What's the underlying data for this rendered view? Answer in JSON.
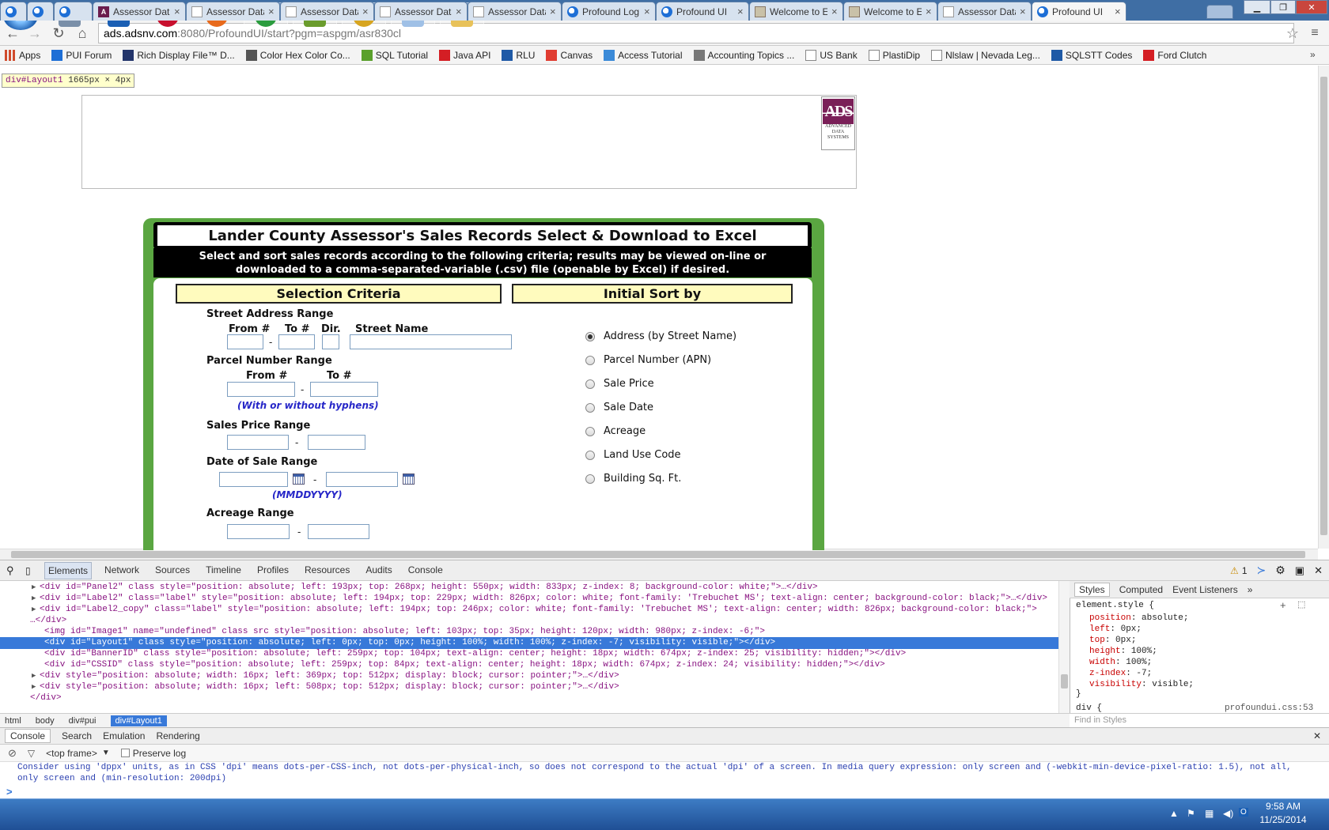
{
  "browser": {
    "tabs": [
      {
        "title": "",
        "icon": "firefox-icon",
        "active": false
      },
      {
        "title": "",
        "icon": "firefox-icon",
        "active": false
      },
      {
        "title": "",
        "icon": "firefox-icon",
        "active": false
      },
      {
        "title": "Assessor Data",
        "icon": "ads-icon",
        "active": false
      },
      {
        "title": "Assessor Data",
        "icon": "document-icon",
        "active": false
      },
      {
        "title": "Assessor Data",
        "icon": "document-icon",
        "active": false
      },
      {
        "title": "Assessor Data",
        "icon": "document-icon",
        "active": false
      },
      {
        "title": "Assessor Data",
        "icon": "document-icon",
        "active": false
      },
      {
        "title": "Profound Log",
        "icon": "firefox-icon",
        "active": false
      },
      {
        "title": "Profound UI",
        "icon": "firefox-icon",
        "active": false
      },
      {
        "title": "Welcome to E",
        "icon": "window-icon",
        "active": false
      },
      {
        "title": "Welcome to E",
        "icon": "window-icon",
        "active": false
      },
      {
        "title": "Assessor Data",
        "icon": "document-icon",
        "active": false
      },
      {
        "title": "Profound UI",
        "icon": "firefox-icon",
        "active": true
      }
    ],
    "url_host": "ads.adsnv.com",
    "url_path": ":8080/ProfoundUI/start?pgm=aspgm/asr830cl",
    "bookmarks": [
      {
        "label": "Apps",
        "icon": "apps-grid-icon",
        "color": "#d04a2c"
      },
      {
        "label": "PUI Forum",
        "icon": "firefox-icon",
        "color": "#1e6fd6"
      },
      {
        "label": "Rich Display File™ D...",
        "icon": "x-logo-icon",
        "color": "#23356b"
      },
      {
        "label": "Color Hex Color Co...",
        "icon": "pin-icon",
        "color": "#555555"
      },
      {
        "label": "SQL Tutorial",
        "icon": "w3-icon",
        "color": "#5aa02c"
      },
      {
        "label": "Java API",
        "icon": "oracle-icon",
        "color": "#d41e24"
      },
      {
        "label": "RLU",
        "icon": "ibm-icon",
        "color": "#1f5aa6"
      },
      {
        "label": "Canvas",
        "icon": "canvas-icon",
        "color": "#e03c31"
      },
      {
        "label": "Access Tutorial",
        "icon": "globe-icon",
        "color": "#3b8ad8"
      },
      {
        "label": "Accounting Topics ...",
        "icon": "ac-icon",
        "color": "#777777"
      },
      {
        "label": "US Bank",
        "icon": "document-icon",
        "color": "#888888"
      },
      {
        "label": "PlastiDip",
        "icon": "document-icon",
        "color": "#888888"
      },
      {
        "label": "Nlslaw | Nevada Leg...",
        "icon": "document-icon",
        "color": "#888888"
      },
      {
        "label": "SQLSTT Codes",
        "icon": "ibm-icon",
        "color": "#1f5aa6"
      },
      {
        "label": "Ford Clutch",
        "icon": "az-icon",
        "color": "#d41e24"
      }
    ]
  },
  "inspect_tooltip": {
    "element": "div#Layout1",
    "size": "1665px × 4px"
  },
  "logo": {
    "mark": "ADS",
    "lines": [
      "ADVANCED",
      "DATA",
      "SYSTEMS"
    ],
    "color": "#7a2058"
  },
  "app": {
    "title": "Lander County Assessor's Sales Records Select & Download to Excel",
    "subtitle_line1": "Select and sort sales records according to the following criteria; results may be viewed on-line or",
    "subtitle_line2": "downloaded to a comma-separated-variable (.csv) file (openable by Excel) if desired.",
    "selection_header": "Selection Criteria",
    "sort_header": "Initial Sort by",
    "street": {
      "label": "Street Address Range",
      "from": "From #",
      "to": "To #",
      "dir": "Dir.",
      "name": "Street Name",
      "from_value": "",
      "to_value": "",
      "dir_value": "",
      "name_value": ""
    },
    "parcel": {
      "label": "Parcel Number Range",
      "from": "From #",
      "to": "To #",
      "hint": "(With or without hyphens)",
      "from_value": "",
      "to_value": ""
    },
    "price": {
      "label": "Sales Price Range",
      "from_value": "",
      "to_value": ""
    },
    "date": {
      "label": "Date of Sale Range",
      "hint": "(MMDDYYYY)",
      "from_value": "",
      "to_value": ""
    },
    "acreage": {
      "label": "Acreage Range",
      "from_value": "",
      "to_value": ""
    },
    "dash": "-",
    "sort_options": [
      {
        "label": "Address (by Street Name)",
        "selected": true
      },
      {
        "label": "Parcel Number (APN)",
        "selected": false
      },
      {
        "label": "Sale Price",
        "selected": false
      },
      {
        "label": "Sale Date",
        "selected": false
      },
      {
        "label": "Acreage",
        "selected": false
      },
      {
        "label": "Land Use Code",
        "selected": false
      },
      {
        "label": "Building Sq. Ft.",
        "selected": false
      }
    ],
    "colors": {
      "panel_green": "#5aa641",
      "header_yellow": "#fffbbe",
      "hint_blue": "#2727c8"
    }
  },
  "devtools": {
    "tabs": [
      "Elements",
      "Network",
      "Sources",
      "Timeline",
      "Profiles",
      "Resources",
      "Audits",
      "Console"
    ],
    "active_tab": "Elements",
    "warning_count": "1",
    "dom_lines": [
      {
        "text": "<div id=\"Panel2\" class style=\"position: absolute; left: 193px; top: 268px; height: 550px; width: 833px; z-index: 8; background-color: white;\">…</div>",
        "arrow": true,
        "selected": false
      },
      {
        "text": "<div id=\"Label2\" class=\"label\" style=\"position: absolute; left: 194px; top: 229px; width: 826px; color: white; font-family: 'Trebuchet MS'; text-align: center; background-color: black;\">…</div>",
        "arrow": true,
        "selected": false
      },
      {
        "text": "<div id=\"Label2_copy\" class=\"label\" style=\"position: absolute; left: 194px; top: 246px; color: white; font-family: 'Trebuchet MS'; text-align: center; width: 826px; background-color: black;\">",
        "arrow": true,
        "selected": false
      },
      {
        "text": "…</div>",
        "arrow": false,
        "selected": false
      },
      {
        "text": "<img id=\"Image1\" name=\"undefined\" class src style=\"position: absolute; left: 103px; top: 35px; height: 120px; width: 980px; z-index: -6;\">",
        "arrow": false,
        "selected": false
      },
      {
        "text": "<div id=\"Layout1\" class style=\"position: absolute; left: 0px; top: 0px; height: 100%; width: 100%; z-index: -7; visibility: visible;\"></div>",
        "arrow": false,
        "selected": true
      },
      {
        "text": "<div id=\"BannerID\" class style=\"position: absolute; left: 259px; top: 104px; text-align: center; height: 18px; width: 674px; z-index: 25; visibility: hidden;\"></div>",
        "arrow": false,
        "selected": false
      },
      {
        "text": "<div id=\"CSSID\" class style=\"position: absolute; left: 259px; top: 84px; text-align: center; height: 18px; width: 674px; z-index: 24; visibility: hidden;\"></div>",
        "arrow": false,
        "selected": false
      },
      {
        "text": "<div style=\"position: absolute; width: 16px; left: 369px; top: 512px; display: block; cursor: pointer;\">…</div>",
        "arrow": true,
        "selected": false
      },
      {
        "text": "<div style=\"position: absolute; width: 16px; left: 508px; top: 512px; display: block; cursor: pointer;\">…</div>",
        "arrow": true,
        "selected": false
      },
      {
        "text": "</div>",
        "arrow": false,
        "selected": false
      }
    ],
    "styles_tabs": [
      "Styles",
      "Computed",
      "Event Listeners"
    ],
    "styles_selector": "element.style {",
    "styles_props": [
      {
        "name": "position",
        "value": "absolute;"
      },
      {
        "name": "left",
        "value": "0px;"
      },
      {
        "name": "top",
        "value": "0px;"
      },
      {
        "name": "height",
        "value": "100%;"
      },
      {
        "name": "width",
        "value": "100%;"
      },
      {
        "name": "z-index",
        "value": "-7;"
      },
      {
        "name": "visibility",
        "value": "visible;"
      }
    ],
    "styles_close": "}",
    "styles_next": "div {",
    "styles_source": "profoundui.css:53",
    "find_placeholder": "Find in Styles",
    "breadcrumbs": [
      "html",
      "body",
      "div#pui",
      "div#Layout1"
    ],
    "drawer_tabs": [
      "Console",
      "Search",
      "Emulation",
      "Rendering"
    ],
    "frame": "<top frame>",
    "preserve_log": "Preserve log",
    "console_message": "Consider using 'dppx' units, as in CSS 'dpi' means dots-per-CSS-inch, not dots-per-physical-inch, so does not correspond to the actual 'dpi' of a screen. In media query expression: only screen and (-webkit-min-device-pixel-ratio: 1.5), not all, only screen and (min-resolution: 200dpi)",
    "prompt": ">"
  },
  "taskbar": {
    "apps": [
      {
        "name": "file-manager-icon",
        "color": "#7a8fa8",
        "label": ""
      },
      {
        "name": "outlook-icon",
        "color": "#1a5fb4",
        "label": "O"
      },
      {
        "name": "itunes-icon",
        "color": "#c8102e",
        "label": "♪"
      },
      {
        "name": "firefox-icon",
        "color": "#e86a1c",
        "label": ""
      },
      {
        "name": "chrome-icon",
        "color": "#2b9c3e",
        "label": ""
      },
      {
        "name": "utility-icon",
        "color": "#6a9c2c",
        "label": ""
      },
      {
        "name": "compass-icon",
        "color": "#d7a520",
        "label": ""
      },
      {
        "name": "notepad-icon",
        "color": "#9fc0e6",
        "label": ""
      },
      {
        "name": "folder-icon",
        "color": "#e8c25a",
        "label": ""
      }
    ],
    "time": "9:58 AM",
    "date": "11/25/2014"
  }
}
